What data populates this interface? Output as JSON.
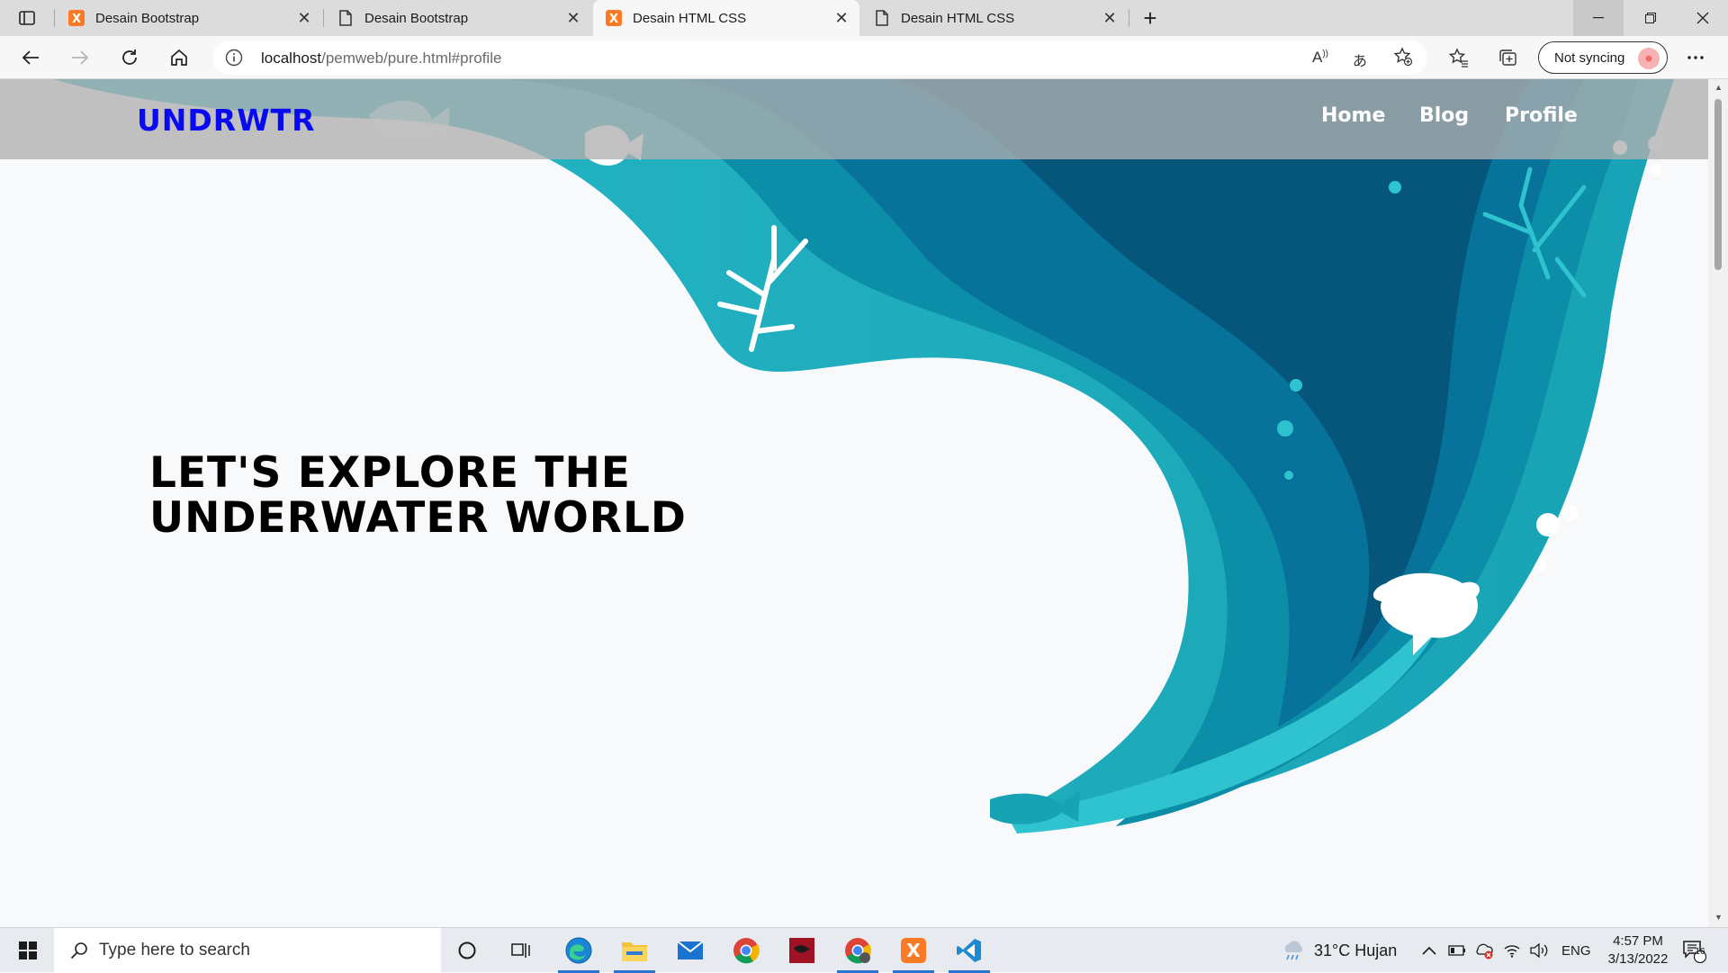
{
  "tabs": [
    {
      "title": "Desain Bootstrap",
      "favicon": "xampp-icon",
      "active": false
    },
    {
      "title": "Desain Bootstrap",
      "favicon": "page-icon",
      "active": false
    },
    {
      "title": "Desain HTML CSS",
      "favicon": "xampp-icon",
      "active": true
    },
    {
      "title": "Desain HTML CSS",
      "favicon": "page-icon",
      "active": false
    }
  ],
  "address": {
    "host": "localhost",
    "path": "/pemweb/pure.html#profile"
  },
  "sync": {
    "label": "Not syncing"
  },
  "site": {
    "brand": "UNDRWTR",
    "nav": [
      "Home",
      "Blog",
      "Profile"
    ],
    "hero_line1": "LET'S EXPLORE THE",
    "hero_line2": "UNDERWATER WORLD"
  },
  "taskbar": {
    "search_placeholder": "Type here to search",
    "weather": "31°C  Hujan",
    "lang": "ENG",
    "time": "4:57 PM",
    "date": "3/13/2022",
    "notifications": "16"
  },
  "colors": {
    "brand": "#0a0af2",
    "navbar": "#afafaf",
    "ocean_light": "#1aa8b8",
    "ocean_dark": "#05567a"
  }
}
